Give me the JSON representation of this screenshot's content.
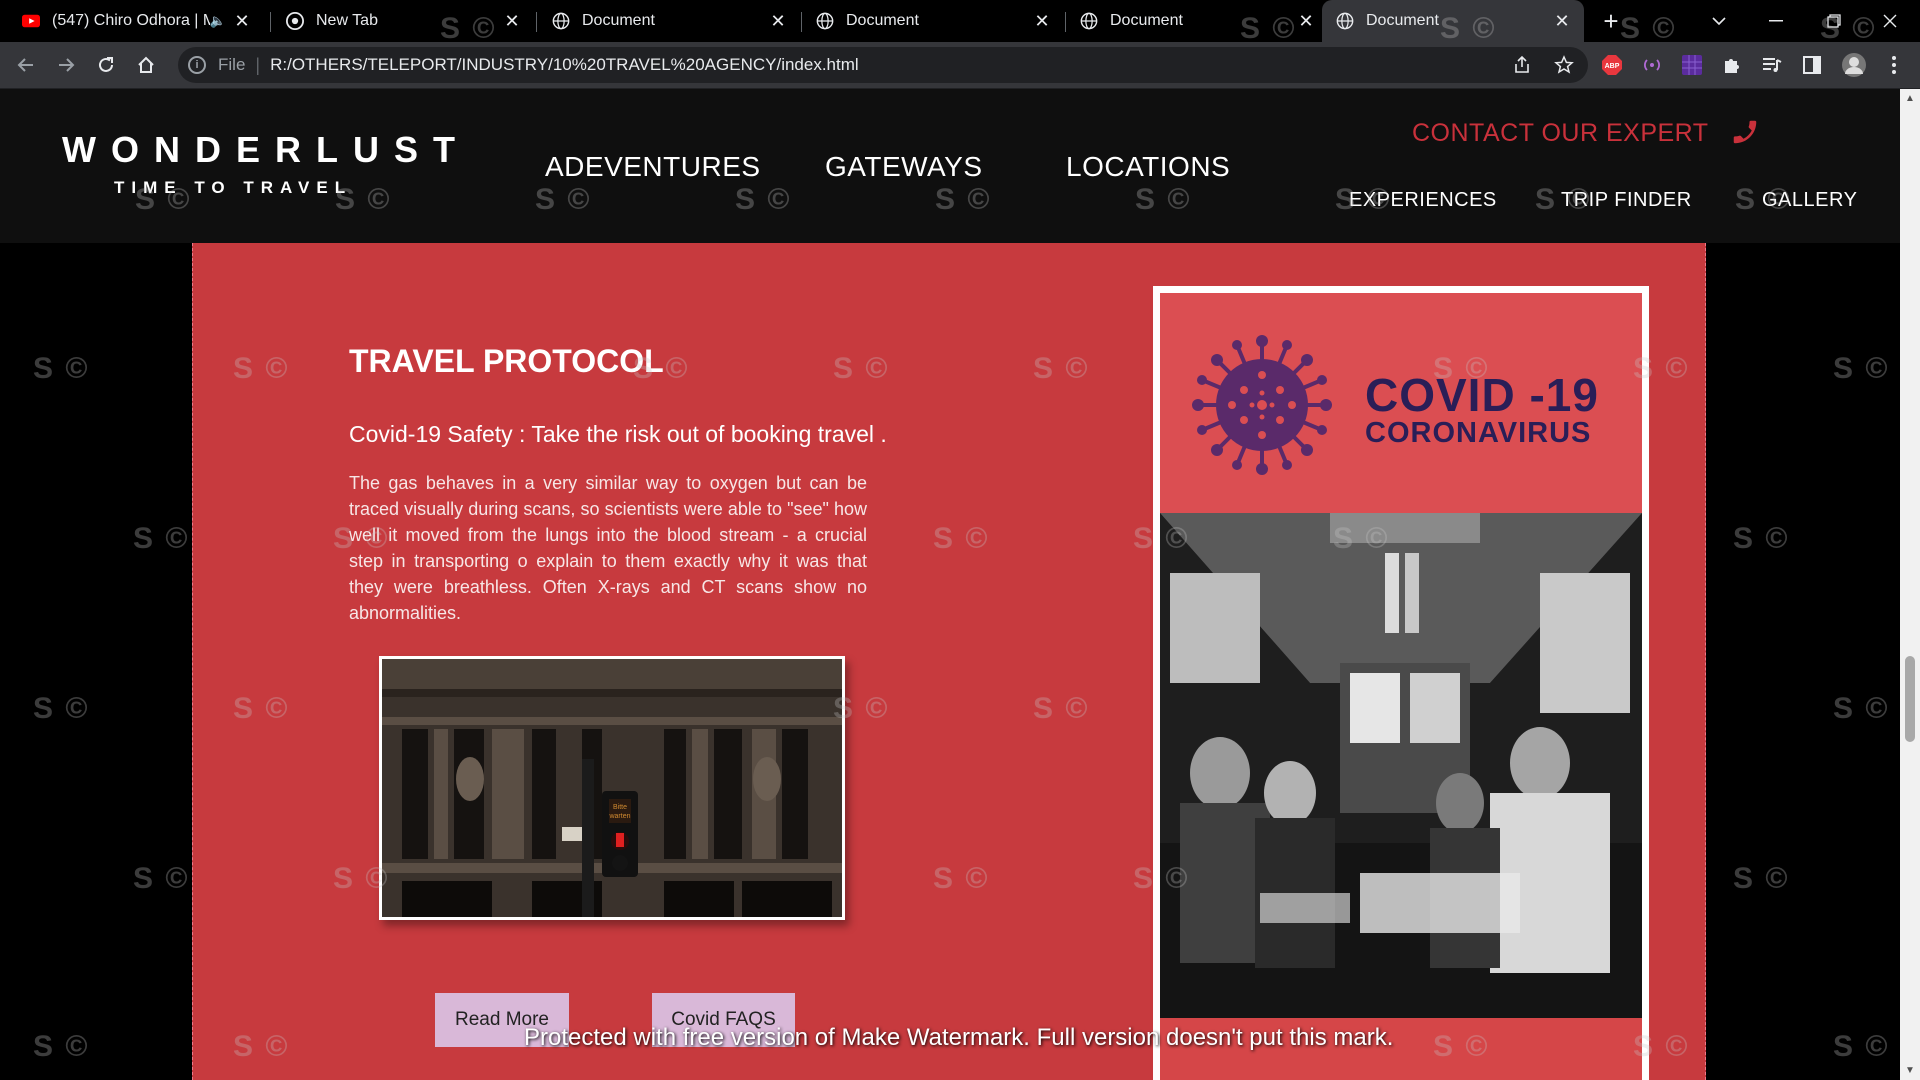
{
  "browser": {
    "tabs": [
      {
        "title": "(547) Chiro Odhora | M",
        "icon": "youtube-icon",
        "active": false
      },
      {
        "title": "New Tab",
        "icon": "chrome-icon",
        "active": false
      },
      {
        "title": "Document",
        "icon": "globe-icon",
        "active": false
      },
      {
        "title": "Document",
        "icon": "globe-icon",
        "active": false
      },
      {
        "title": "Document",
        "icon": "globe-icon",
        "active": false
      },
      {
        "title": "Document",
        "icon": "globe-icon",
        "active": true
      }
    ],
    "address": {
      "scheme": "File",
      "url": "R:/OTHERS/TELEPORT/INDUSTRY/10%20TRAVEL%20AGENCY/index.html"
    }
  },
  "header": {
    "brand": "WONDERLUST",
    "tagline": "TIME TO TRAVEL",
    "main_nav": [
      "ADEVENTURES",
      "GATEWAYS",
      "LOCATIONS"
    ],
    "contact": "CONTACT OUR EXPERT",
    "sub_nav": [
      "EXPERIENCES",
      "TRIP FINDER",
      "GALLERY"
    ]
  },
  "section": {
    "title": "TRAVEL PROTOCOL",
    "subtitle": "Covid-19 Safety : Take the risk out of booking travel .",
    "body": "The gas behaves in a very similar way to oxygen but can be traced visually during scans, so scientists were able to \"see\" how well it moved from the lungs into the blood stream - a crucial step in transporting o explain to them exactly why it was that they were breathless. Often X-rays and CT scans show no abnormalities.",
    "buttons": {
      "read_more": "Read More",
      "faqs": "Covid FAQS"
    }
  },
  "poster": {
    "title": "COVID -19",
    "subtitle": "CORONAVIRUS"
  },
  "watermark": {
    "mark": "S ©",
    "banner": "Protected with free version of Make Watermark. Full version doesn't put this mark."
  },
  "colors": {
    "accent_red": "#c73a3e",
    "contact_red": "#c9313b",
    "covid_navy": "#2a1e57",
    "button_lilac": "#d9b8d8"
  }
}
